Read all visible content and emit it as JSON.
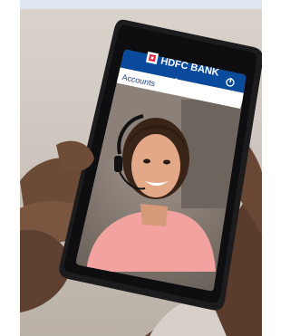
{
  "app": {
    "brand_name": "HDFC BANK",
    "section_title": "Accounts",
    "header_color": "#0a4a9c",
    "logo_accent": "#e31837"
  },
  "icons": {
    "power": "power-icon",
    "logo": "hdfc-logo-icon"
  }
}
